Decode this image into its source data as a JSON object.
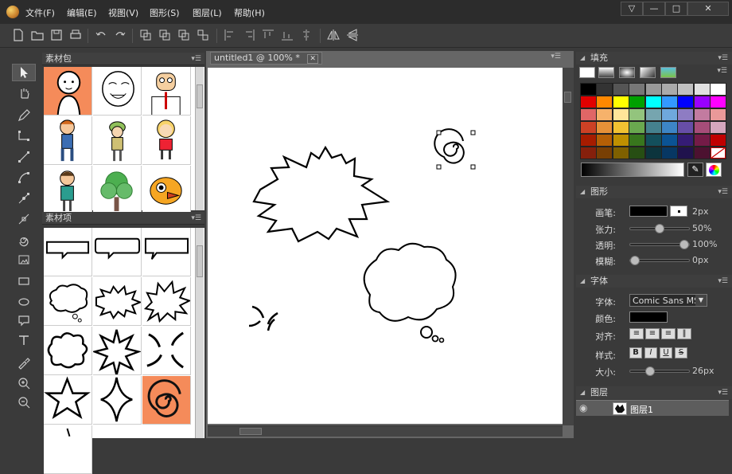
{
  "menu": {
    "items": [
      "文件(F)",
      "编辑(E)",
      "视图(V)",
      "图形(S)",
      "图层(L)",
      "帮助(H)"
    ]
  },
  "window": {
    "btn_options": "▽",
    "btn_min": "—",
    "btn_max": "□",
    "btn_close": "✕"
  },
  "left_panels": {
    "assets_title": "素材包",
    "items_title": "素材项"
  },
  "document": {
    "tab_label": "untitled1 @ 100% *",
    "tab_close": "✕"
  },
  "right_panel": {
    "fill_title": "填充",
    "shape_title": "图形",
    "brush_label": "画笔:",
    "brush_value": "2px",
    "tension_label": "张力:",
    "tension_value": "50%",
    "tension_level": 0.5,
    "opacity_label": "透明:",
    "opacity_value": "100%",
    "opacity_level": 1.0,
    "blur_label": "模糊:",
    "blur_value": "0px",
    "blur_level": 0.0,
    "font_title": "字体",
    "font_label": "字体:",
    "font_value": "Comic Sans MS",
    "color_label": "颜色:",
    "align_label": "对齐:",
    "style_label": "样式:",
    "style_bold": "B",
    "style_italic": "I",
    "style_underline": "U",
    "style_strike": "S",
    "size_label": "大小:",
    "size_value": "26px",
    "size_level": 0.3,
    "layers_title": "图层",
    "layer_name": "图层1"
  },
  "palette": [
    "#000000",
    "#333333",
    "#555555",
    "#777777",
    "#999999",
    "#aaaaaa",
    "#c0c0c0",
    "#e0e0e0",
    "#ffffff",
    "#e00000",
    "#ff8800",
    "#ffff00",
    "#00a000",
    "#00ffff",
    "#3399ff",
    "#0000ff",
    "#9900ff",
    "#ff00ff",
    "#e06666",
    "#f6b26b",
    "#ffe599",
    "#93c47d",
    "#76a5af",
    "#6fa8dc",
    "#8e7cc3",
    "#c27ba0",
    "#ea9999",
    "#cc4125",
    "#e69138",
    "#f1c232",
    "#6aa84f",
    "#45818e",
    "#3d85c6",
    "#674ea7",
    "#a64d79",
    "#d5a6bd",
    "#a61c00",
    "#b45f06",
    "#bf9000",
    "#38761d",
    "#134f5c",
    "#0b5394",
    "#351c75",
    "#741b47",
    "#c00000",
    "#85200c",
    "#783f04",
    "#7f6000",
    "#274e13",
    "#0c343d",
    "#073763",
    "#20124d",
    "#4c1130",
    "none"
  ]
}
